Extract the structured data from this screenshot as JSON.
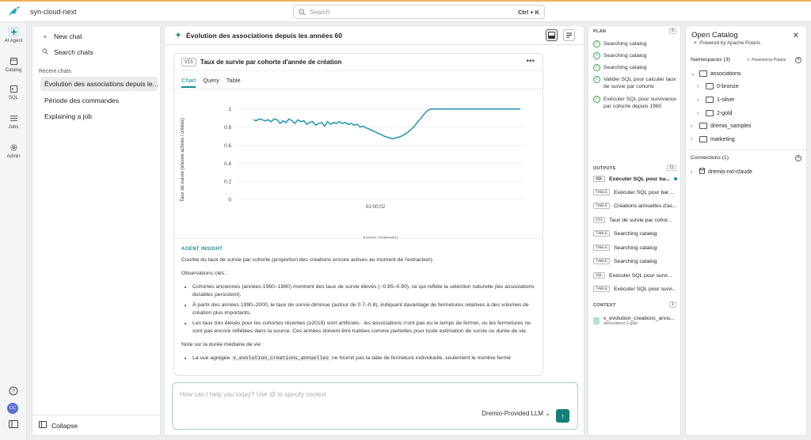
{
  "topbar": {
    "project": "syn-cloud-next",
    "search_placeholder": "Search",
    "shortcut": "Ctrl + K"
  },
  "nav": {
    "items": [
      {
        "label": "AI Agent",
        "icon": "ai-agent-icon"
      },
      {
        "label": "Catalog",
        "icon": "catalog-icon"
      },
      {
        "label": "SQL",
        "icon": "sql-icon"
      },
      {
        "label": "Jobs",
        "icon": "jobs-icon"
      },
      {
        "label": "Admin",
        "icon": "admin-icon"
      }
    ],
    "avatar": "CC"
  },
  "chats": {
    "new_chat": "New chat",
    "search_chats": "Search chats",
    "recent_label": "Recent chats",
    "items": [
      "Évolution des associations depuis le...",
      "Période des commandes",
      "Explaining a job"
    ],
    "collapse": "Collapse"
  },
  "main": {
    "title": "Évolution des associations depuis les années 60",
    "card": {
      "tag": "VIS",
      "title": "Taux de survie par cohorte d'année de création",
      "tabs": [
        "Chart",
        "Query",
        "Table"
      ]
    },
    "insight": {
      "label": "AGENT INSIGHT",
      "intro": "Courbe du taux de survie par cohorte (proportion des créations encore actives au moment de l'extraction).",
      "obs_title": "Observations clés :",
      "bullets": [
        "Cohortes anciennes (années 1960–1980) montrent des taux de survie élevés (~0.85–0.90), ce qui reflète la sélection naturelle (les associations durables persistent).",
        "À partir des années 1990–2000, le taux de survie diminue (autour de 0.7–0.8), indiquant davantage de fermetures relatives à des volumes de création plus importants.",
        "Les taux très élevés pour les cohortes récentes (≥2019) sont artificiels : les associations n'ont pas eu le temps de fermer, ou les fermetures ne sont pas encore reflétées dans la source. Ces années doivent être traitées comme partielles pour toute estimation de survie ou durée de vie."
      ],
      "note_title": "Note sur la durée médiane de vie :",
      "note_pre": "La vue agrégée",
      "note_code": "v_evolution_creations_annuelles",
      "note_post": "ne fournit pas la date de fermeture individuelle, seulement le nombre fermé"
    },
    "composer": {
      "placeholder": "How can I help you today? Use @ to specify context",
      "model": "Dremio-Provided LLM"
    }
  },
  "chart_data": {
    "type": "line",
    "xlabel": "Année (cohorte)",
    "ylabel": "Taux de survie (encore actives / créées)",
    "x_tick": "01:00:02",
    "yticks": [
      "1",
      "0.8",
      "0.6",
      "0.4",
      "0.2",
      "0"
    ],
    "ylim": [
      0,
      1.05
    ],
    "color": "#2a9bb0",
    "series": [
      {
        "values": [
          0.88,
          0.87,
          0.89,
          0.88,
          0.87,
          0.88,
          0.86,
          0.89,
          0.88,
          0.84,
          0.87,
          0.85,
          0.89,
          0.87,
          0.84,
          0.88,
          0.86,
          0.87,
          0.83,
          0.85,
          0.86,
          0.82,
          0.84,
          0.85,
          0.81,
          0.86,
          0.83,
          0.85,
          0.84,
          0.86,
          0.84,
          0.85,
          0.83,
          0.84,
          0.82,
          0.83,
          0.8,
          0.81,
          0.79,
          0.78,
          0.76,
          0.75,
          0.73,
          0.72,
          0.7,
          0.69,
          0.68,
          0.67,
          0.68,
          0.69,
          0.7,
          0.72,
          0.74,
          0.77,
          0.8,
          0.84,
          0.88,
          0.92,
          0.96,
          0.99,
          1.0,
          1.0,
          1.0,
          1.0,
          1.0,
          1.0,
          1.0,
          1.0,
          1.0,
          1.0,
          1.0,
          1.0,
          1.0,
          1.0,
          1.0,
          1.0,
          1.0,
          1.0,
          1.0,
          1.0,
          1.0,
          1.0,
          1.0,
          1.0,
          1.0,
          1.0,
          1.0,
          1.0,
          1.0,
          1.0,
          1.0
        ]
      }
    ]
  },
  "plan": {
    "label": "PLAN",
    "count": "5",
    "steps": [
      "Searching catalog",
      "Searching catalog",
      "Searching catalog",
      "Valider SQL pour calculer taux de survie par cohorte",
      "Exécuter SQL pour survivance par cohorte depuis 1960"
    ]
  },
  "outputs": {
    "label": "OUTPUTS",
    "count": "11",
    "items": [
      {
        "tag": "SQL",
        "text": "Exécuter SQL pour ba..."
      },
      {
        "tag": "TABLE",
        "text": "Exécuter SQL pour bar ..."
      },
      {
        "tag": "TABLE",
        "text": "Créations annuelles d'as..."
      },
      {
        "tag": "VIS",
        "text": "Taux de survie par cohor..."
      },
      {
        "tag": "TABLE",
        "text": "Searching catalog"
      },
      {
        "tag": "TABLE",
        "text": "Searching catalog"
      },
      {
        "tag": "TABLE",
        "text": "Searching catalog"
      },
      {
        "tag": "SQL",
        "text": "Exécuter SQL pour survi..."
      },
      {
        "tag": "TABLE",
        "text": "Exécuter SQL pour survi..."
      }
    ]
  },
  "context": {
    "label": "CONTEXT",
    "count": "1",
    "name": "v_evolution_creations_annu...",
    "sub": "associations.2-gold"
  },
  "catalog": {
    "title": "Open Catalog",
    "subtitle": "Powered by Apache Polaris",
    "namespaces_label": "Namespaces (3)",
    "powered_small": "Powered by Polaris",
    "tree": [
      "associations",
      "0-bronze",
      "1-silver",
      "2-gold",
      "dremio_samples",
      "marketing"
    ],
    "connections_label": "Connections (1)",
    "connection": "dremio-nxt-claude"
  }
}
